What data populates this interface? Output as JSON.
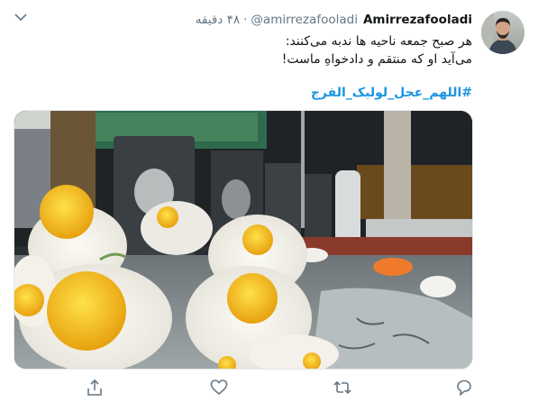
{
  "tweet": {
    "display_name": "Amirrezafooladi",
    "handle": "@amirrezafooladi",
    "separator": "·",
    "timestamp": "۴۸ دقیقه",
    "text_line_1": "هر صبح جمعه ناحیه ها ندبه می‌کنند:",
    "text_line_2": "می‌آید او که منتقم و دادخواهِ ماست!",
    "hashtag": "#اللهم_عجل_لولیک_الفرج"
  },
  "icons": {
    "menu": "chevron-down-icon",
    "share": "share-icon",
    "like": "heart-icon",
    "retweet": "retweet-icon",
    "reply": "reply-icon"
  },
  "colors": {
    "link": "#1b95e0",
    "muted": "#657786",
    "text": "#14171a"
  }
}
